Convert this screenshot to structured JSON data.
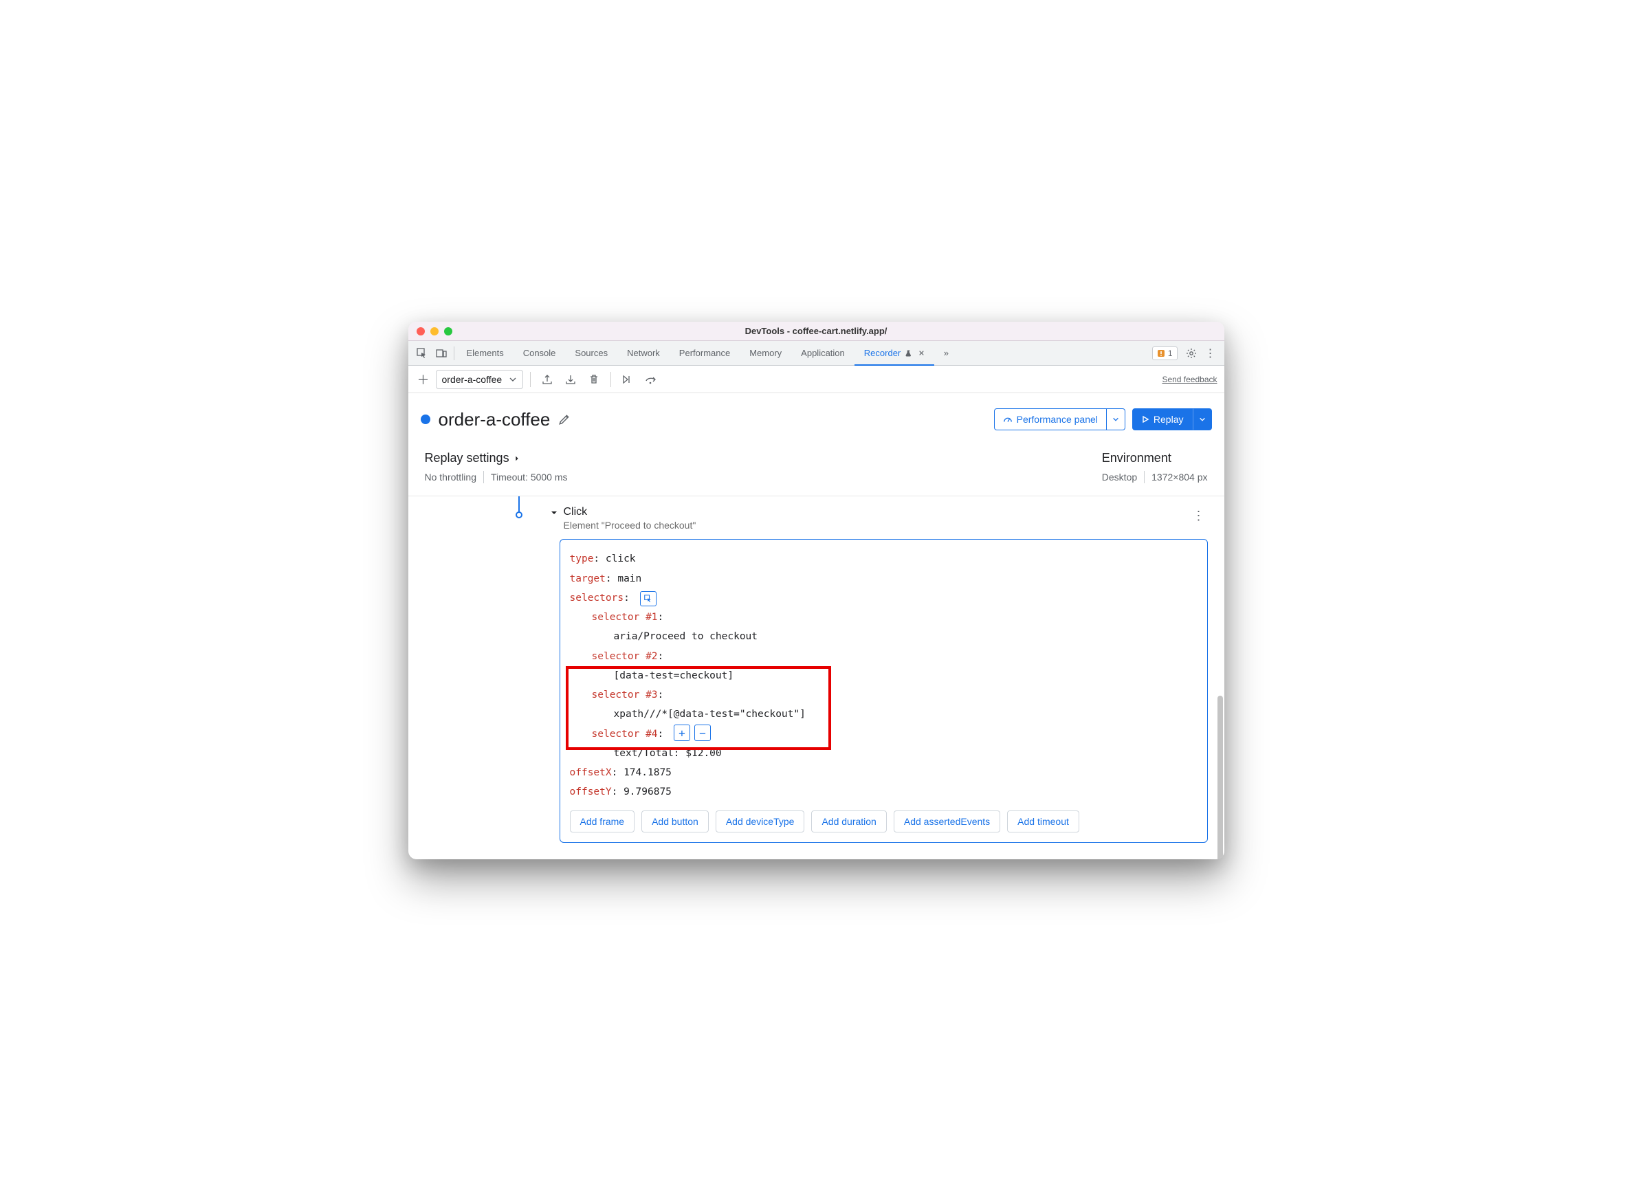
{
  "window": {
    "title": "DevTools - coffee-cart.netlify.app/"
  },
  "tabs": {
    "items": [
      "Elements",
      "Console",
      "Sources",
      "Network",
      "Performance",
      "Memory",
      "Application",
      "Recorder"
    ],
    "more": "»",
    "warn_count": "1"
  },
  "toolbar": {
    "recording_name": "order-a-coffee",
    "feedback": "Send feedback"
  },
  "header": {
    "title": "order-a-coffee",
    "perf_label": "Performance panel",
    "replay_label": "Replay"
  },
  "settings": {
    "replay_title": "Replay settings",
    "throttling": "No throttling",
    "timeout": "Timeout: 5000 ms",
    "env_title": "Environment",
    "env_device": "Desktop",
    "env_dims": "1372×804 px"
  },
  "step": {
    "name": "Click",
    "desc": "Element \"Proceed to checkout\"",
    "type_k": "type",
    "type_v": ": click",
    "target_k": "target",
    "target_v": ": main",
    "selectors_k": "selectors",
    "selectors_v": ":",
    "sel1_k": "selector #1",
    "sel1_v": ":",
    "sel1_body": "aria/Proceed to checkout",
    "sel2_k": "selector #2",
    "sel2_v": ":",
    "sel2_body": "[data-test=checkout]",
    "sel3_k": "selector #3",
    "sel3_v": ":",
    "sel3_body": "xpath///*[@data-test=\"checkout\"]",
    "sel4_k": "selector #4",
    "sel4_v": ":",
    "sel4_body": "text/Total: $12.00",
    "offx_k": "offsetX",
    "offx_v": ": 174.1875",
    "offy_k": "offsetY",
    "offy_v": ": 9.796875"
  },
  "add_buttons": [
    "Add frame",
    "Add button",
    "Add deviceType",
    "Add duration",
    "Add assertedEvents",
    "Add timeout"
  ]
}
